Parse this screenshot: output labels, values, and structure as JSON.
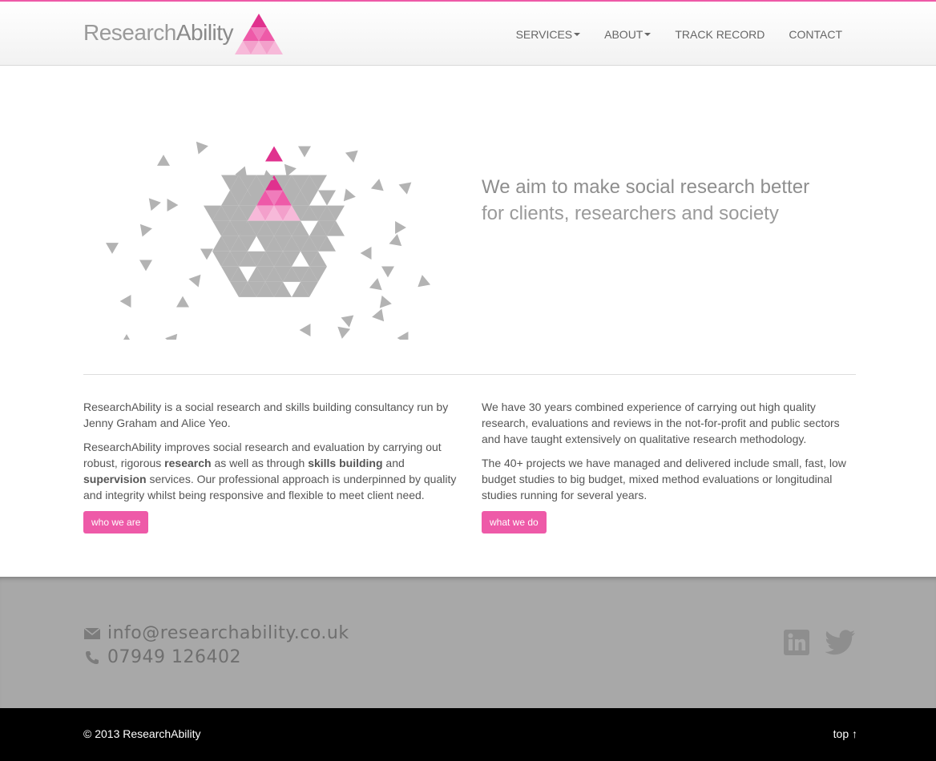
{
  "brand": {
    "name_part1": "Research",
    "name_part2": "Ability",
    "accent": "#ee5aa8",
    "accent_dark": "#e0318e",
    "accent_light": "#f7b9d9"
  },
  "nav": {
    "items": [
      {
        "label": "SERVICES",
        "dropdown": true
      },
      {
        "label": "ABOUT",
        "dropdown": true
      },
      {
        "label": "TRACK RECORD",
        "dropdown": false
      },
      {
        "label": "CONTACT",
        "dropdown": false
      }
    ]
  },
  "hero": {
    "tagline_1": "We aim to make social research better",
    "tagline_2": "for clients, researchers and society"
  },
  "left": {
    "p1": "ResearchAbility is a social research and skills building consultancy run by Jenny Graham and Alice Yeo.",
    "p2_a": "ResearchAbility improves social research and evaluation by carrying out robust, rigorous ",
    "p2_b": "research",
    "p2_c": " as well as through ",
    "p2_d": "skills building",
    "p2_e": " and ",
    "p2_f": "supervision",
    "p2_g": " services. Our professional approach is underpinned by quality and integrity whilst being responsive and flexible to meet client need.",
    "button": "who we are"
  },
  "right": {
    "p1": "We have 30 years combined experience of carrying out high quality research, evaluations and reviews in the not-for-profit and public sectors and have taught extensively on qualitative research methodology.",
    "p2": "The 40+ projects we have managed and delivered include small, fast, low budget studies to big budget, mixed method evaluations or longitudinal studies running for several years.",
    "button": "what we do"
  },
  "contact": {
    "email": "info@researchability.co.uk",
    "phone": "07949 126402",
    "icons": [
      "envelope-icon",
      "phone-icon",
      "linkedin-icon",
      "twitter-icon"
    ]
  },
  "footer": {
    "copyright": "© 2013 ResearchAbility",
    "top_link": "top ↑"
  }
}
